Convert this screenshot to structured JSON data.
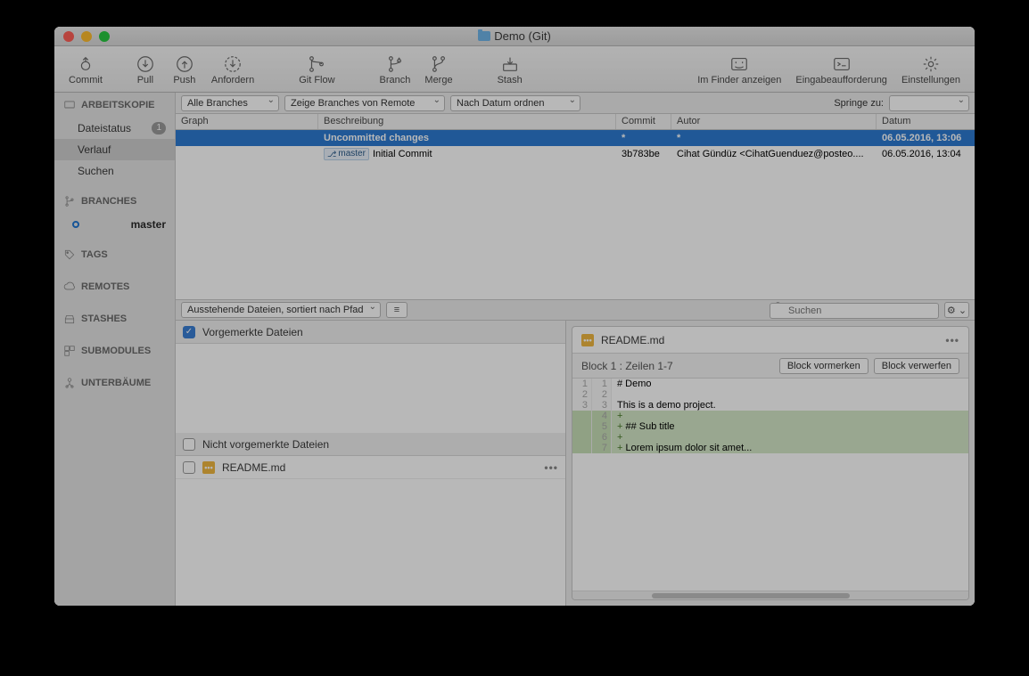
{
  "title": "Demo (Git)",
  "toolbar": {
    "commit": "Commit",
    "pull": "Pull",
    "push": "Push",
    "fetch": "Anfordern",
    "gitflow": "Git Flow",
    "branch": "Branch",
    "merge": "Merge",
    "stash": "Stash",
    "finder": "Im Finder anzeigen",
    "terminal": "Eingabeaufforderung",
    "settings": "Einstellungen"
  },
  "sidebar": {
    "workingcopy": "ARBEITSKOPIE",
    "filestatus": "Dateistatus",
    "filestatus_badge": "1",
    "history": "Verlauf",
    "search": "Suchen",
    "branches": "BRANCHES",
    "master": "master",
    "tags": "TAGS",
    "remotes": "REMOTES",
    "stashes": "STASHES",
    "submodules": "SUBMODULES",
    "subtrees": "UNTERBÄUME"
  },
  "filter": {
    "branches": "Alle Branches",
    "remote": "Zeige Branches von Remote",
    "sort": "Nach Datum ordnen",
    "jump_label": "Springe zu:"
  },
  "columns": {
    "graph": "Graph",
    "desc": "Beschreibung",
    "commit": "Commit",
    "author": "Autor",
    "date": "Datum"
  },
  "commits": [
    {
      "desc": "Uncommitted changes",
      "tag": "",
      "hash": "*",
      "author": "*",
      "date": "06.05.2016, 13:06",
      "selected": true
    },
    {
      "desc": "Initial Commit",
      "tag": "master",
      "hash": "3b783be",
      "author": "Cihat Gündüz <CihatGuenduez@posteo....",
      "date": "06.05.2016, 13:04",
      "selected": false
    }
  ],
  "file_toolbar": {
    "pending": "Ausstehende Dateien, sortiert nach Pfad",
    "search_placeholder": "Suchen"
  },
  "files": {
    "staged_header": "Vorgemerkte Dateien",
    "unstaged_header": "Nicht vorgemerkte Dateien",
    "readme": "README.md"
  },
  "diff": {
    "filename": "README.md",
    "hunk_label": "Block 1 : Zeilen 1-7",
    "stage_btn": "Block vormerken",
    "discard_btn": "Block verwerfen",
    "lines": [
      {
        "old": "1",
        "new": "1",
        "text": "# Demo",
        "type": "ctx"
      },
      {
        "old": "2",
        "new": "2",
        "text": "",
        "type": "ctx"
      },
      {
        "old": "3",
        "new": "3",
        "text": "This is a demo project.",
        "type": "ctx"
      },
      {
        "old": "",
        "new": "4",
        "text": "",
        "type": "add"
      },
      {
        "old": "",
        "new": "5",
        "text": "## Sub title",
        "type": "add"
      },
      {
        "old": "",
        "new": "6",
        "text": "",
        "type": "add"
      },
      {
        "old": "",
        "new": "7",
        "text": "Lorem ipsum dolor sit amet...",
        "type": "add"
      }
    ]
  }
}
